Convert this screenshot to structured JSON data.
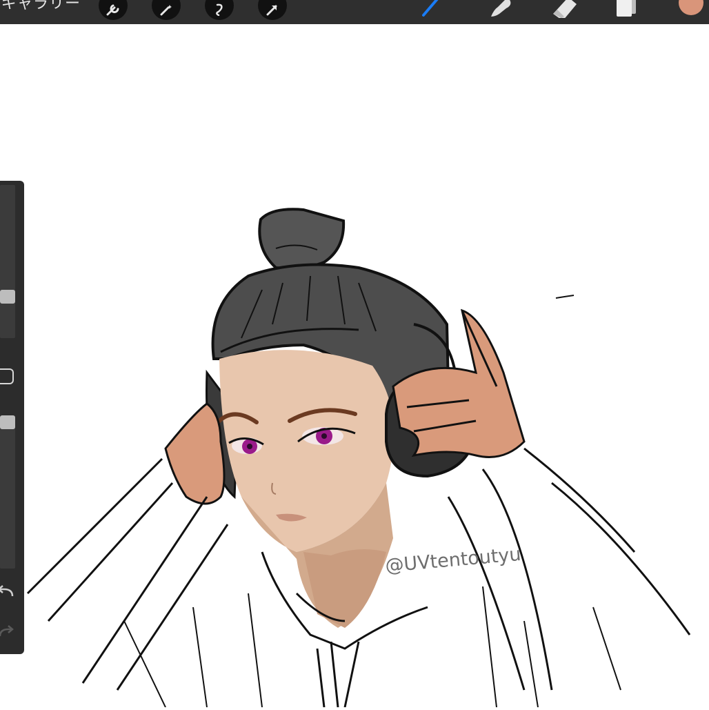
{
  "topbar": {
    "gallery_label": "ギャラリー",
    "left_tools": [
      "wrench-icon",
      "magic-wand-icon",
      "selection-icon",
      "transform-arrow-icon"
    ],
    "right_tools": [
      "brush-icon",
      "smudge-icon",
      "eraser-icon",
      "layers-icon"
    ],
    "active_tool": "brush-icon",
    "accent_color": "#1a7cf5",
    "current_color": "#d9957a"
  },
  "sidebar": {
    "icons": [
      "modify-square-icon",
      "undo-icon",
      "redo-icon"
    ]
  },
  "canvas": {
    "watermark": "@UVtentoutyu"
  }
}
